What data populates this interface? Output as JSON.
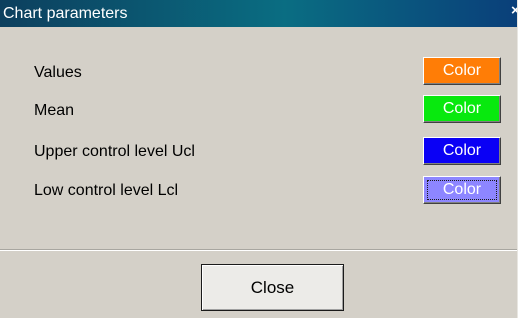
{
  "window": {
    "title": "Chart parameters",
    "close_glyph": "×"
  },
  "parameters": [
    {
      "label": "Values",
      "button_label": "Color",
      "color": "#ff7d06"
    },
    {
      "label": "Mean",
      "button_label": "Color",
      "color": "#08e90e"
    },
    {
      "label": "Upper control level Ucl",
      "button_label": "Color",
      "color": "#0a00f5"
    },
    {
      "label": "Low control level Lcl",
      "button_label": "Color",
      "color": "#8d86ff"
    }
  ],
  "footer": {
    "close_label": "Close"
  }
}
